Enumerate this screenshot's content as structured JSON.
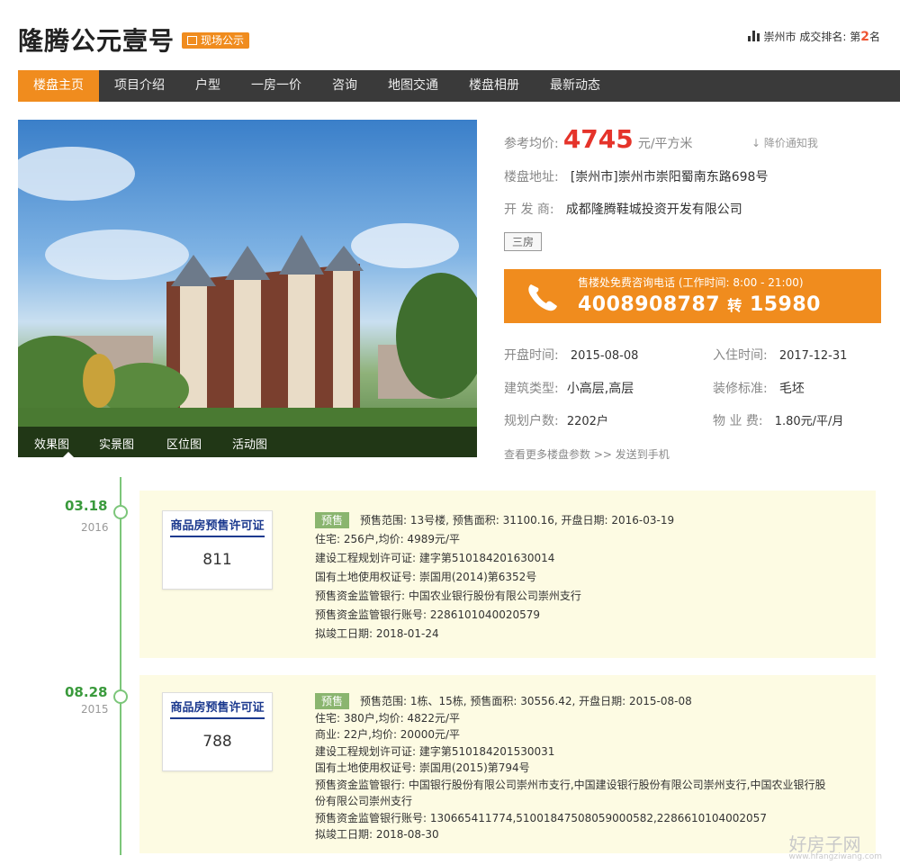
{
  "header": {
    "title": "隆腾公元壹号",
    "badge": "现场公示",
    "rank_prefix": "崇州市 成交排名: 第",
    "rank_num": "2",
    "rank_suffix": "名"
  },
  "nav": {
    "items": [
      "楼盘主页",
      "项目介绍",
      "户型",
      "一房一价",
      "咨询",
      "地图交通",
      "楼盘相册",
      "最新动态"
    ]
  },
  "photo": {
    "tabs": [
      "效果图",
      "实景图",
      "区位图",
      "活动图"
    ]
  },
  "info": {
    "price_label": "参考均价:",
    "price_value": "4745",
    "price_unit": "元/平方米",
    "notify": "降价通知我",
    "address_label": "楼盘地址:",
    "address_value": "[崇州市]崇州市崇阳蜀南东路698号",
    "developer_label": "开 发 商:",
    "developer_value": "成都隆腾鞋城投资开发有限公司",
    "tag": "三房",
    "hotline_sub": "售楼处免费咨询电话 (工作时间: 8:00 - 21:00)",
    "hotline_number": "4008908787",
    "hotline_zhuan": "转",
    "hotline_ext": "15980",
    "open_label": "开盘时间:",
    "open_value": "2015-08-08",
    "movein_label": "入住时间:",
    "movein_value": "2017-12-31",
    "type_label": "建筑类型:",
    "type_value": "小高层,高层",
    "decor_label": "装修标准:",
    "decor_value": "毛坯",
    "households_label": "规划户数:",
    "households_value": "2202户",
    "fee_label": "物 业 费:",
    "fee_value": "1.80元/平/月",
    "more": "查看更多楼盘参数 >> 发送到手机"
  },
  "timeline": [
    {
      "date": "03.18",
      "year": "2016",
      "permit_title": "商品房预售许可证",
      "permit_no": "811",
      "presale": "预售",
      "lines": [
        "预售范围: 13号楼, 预售面积: 31100.16, 开盘日期: 2016-03-19",
        "住宅: 256户,均价: 4989元/平",
        "建设工程规划许可证: 建字第510184201630014",
        "国有土地使用权证号: 崇国用(2014)第6352号",
        "预售资金监管银行: 中国农业银行股份有限公司崇州支行",
        "预售资金监管银行账号: 2286101040020579",
        "拟竣工日期: 2018-01-24"
      ]
    },
    {
      "date": "08.28",
      "year": "2015",
      "permit_title": "商品房预售许可证",
      "permit_no": "788",
      "presale": "预售",
      "lines": [
        "预售范围: 1栋、15栋, 预售面积: 30556.42, 开盘日期: 2015-08-08",
        "住宅: 380户,均价: 4822元/平",
        "商业: 22户,均价: 20000元/平",
        "建设工程规划许可证: 建字第510184201530031",
        "国有土地使用权证号: 崇国用(2015)第794号",
        "预售资金监管银行: 中国银行股份有限公司崇州市支行,中国建设银行股份有限公司崇州支行,中国农业银行股",
        "份有限公司崇州支行",
        "预售资金监管银行账号: 130665411774,51001847508059000582,2286610104002057",
        "拟竣工日期: 2018-08-30"
      ]
    }
  ],
  "watermark": {
    "text": "好房子网",
    "url": "www.hfangziwang.com"
  },
  "colors": {
    "accent": "#f08c1e",
    "price": "#e5332a",
    "nav_bg": "#3a3a3a",
    "timeline": "#7cc67a",
    "card_bg": "#fdfbe3"
  }
}
